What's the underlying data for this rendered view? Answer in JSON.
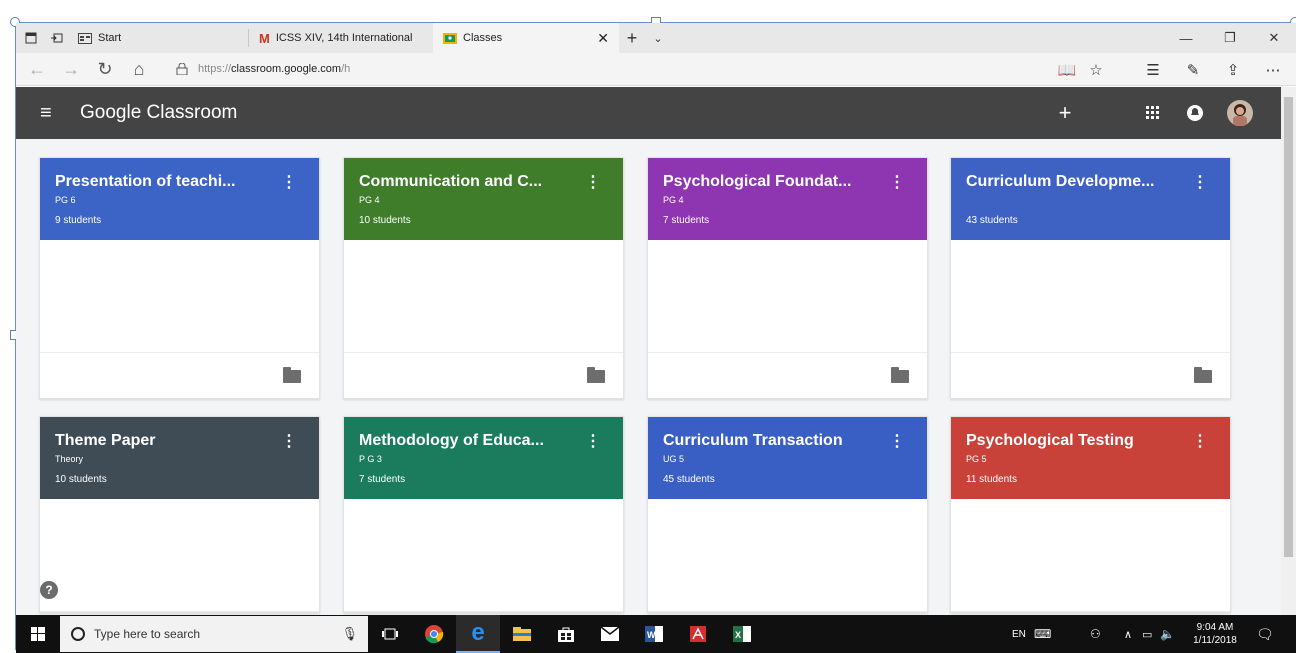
{
  "browser": {
    "tabs": [
      {
        "label": "Start",
        "icon": "start-page-icon"
      },
      {
        "label": "ICSS XIV, 14th International",
        "icon": "gmail-icon"
      },
      {
        "label": "Classes",
        "icon": "classroom-icon"
      }
    ],
    "url_prefix": "https://",
    "url_host": "classroom.google.com",
    "url_path": "/h"
  },
  "app": {
    "title": "Google Classroom",
    "add_label": "+"
  },
  "classes": [
    {
      "title": "Presentation of teachi...",
      "section": "PG 6",
      "students": "9 students",
      "color": "#3c64c6"
    },
    {
      "title": "Communication and C...",
      "section": "PG 4",
      "students": "10 students",
      "color": "#3f7d2b"
    },
    {
      "title": "Psychological Foundat...",
      "section": "PG 4",
      "students": "7 students",
      "color": "#8e35b2"
    },
    {
      "title": "Curriculum Developme...",
      "section": "",
      "students": "43 students",
      "color": "#3e61c4"
    },
    {
      "title": "Theme Paper",
      "section": "Theory",
      "students": "10 students",
      "color": "#3f4c55"
    },
    {
      "title": "Methodology of Educa...",
      "section": "P G 3",
      "students": "7 students",
      "color": "#1b7c5d"
    },
    {
      "title": "Curriculum Transaction",
      "section": "UG 5",
      "students": "45 students",
      "color": "#3a5fc4"
    },
    {
      "title": "Psychological Testing",
      "section": "PG 5",
      "students": "11 students",
      "color": "#c9423a"
    }
  ],
  "help_label": "?",
  "taskbar": {
    "search_placeholder": "Type here to search",
    "lang": "EN",
    "time": "9:04 AM",
    "date": "1/11/2018"
  }
}
